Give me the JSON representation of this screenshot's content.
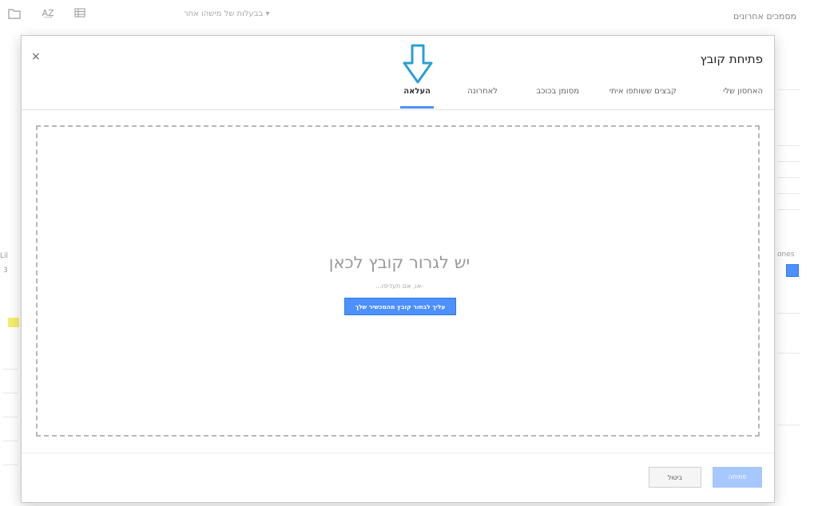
{
  "background": {
    "sort_label": "▾ בבעלות של מישהו אחר",
    "title": "מסמכים אחרונים",
    "right_label": "ones",
    "left_label": "Lil",
    "left_label2": "3"
  },
  "toolbar_icons": [
    "folder-icon",
    "sort-az-icon",
    "grid-view-icon"
  ],
  "dialog": {
    "close_label": "×",
    "title": "פתיחת קובץ",
    "tabs": [
      {
        "label": "האחסון שלי",
        "active": false
      },
      {
        "label": "קבצים ששותפו איתי",
        "active": false
      },
      {
        "label": "מסומן בכוכב",
        "active": false
      },
      {
        "label": "לאחרונה",
        "active": false
      },
      {
        "label": "העלאה",
        "active": true
      }
    ],
    "dropzone": {
      "title": "יש לגרור קובץ לכאן",
      "or_text": "-או, אם תעדיפו...",
      "select_button": "עליך לבחור קובץ מהמכשיר שלך"
    },
    "footer": {
      "cancel": "ביטול",
      "select": "פתיחה"
    }
  },
  "colors": {
    "accent": "#4d90fe",
    "arrow": "#2a9fd6"
  }
}
